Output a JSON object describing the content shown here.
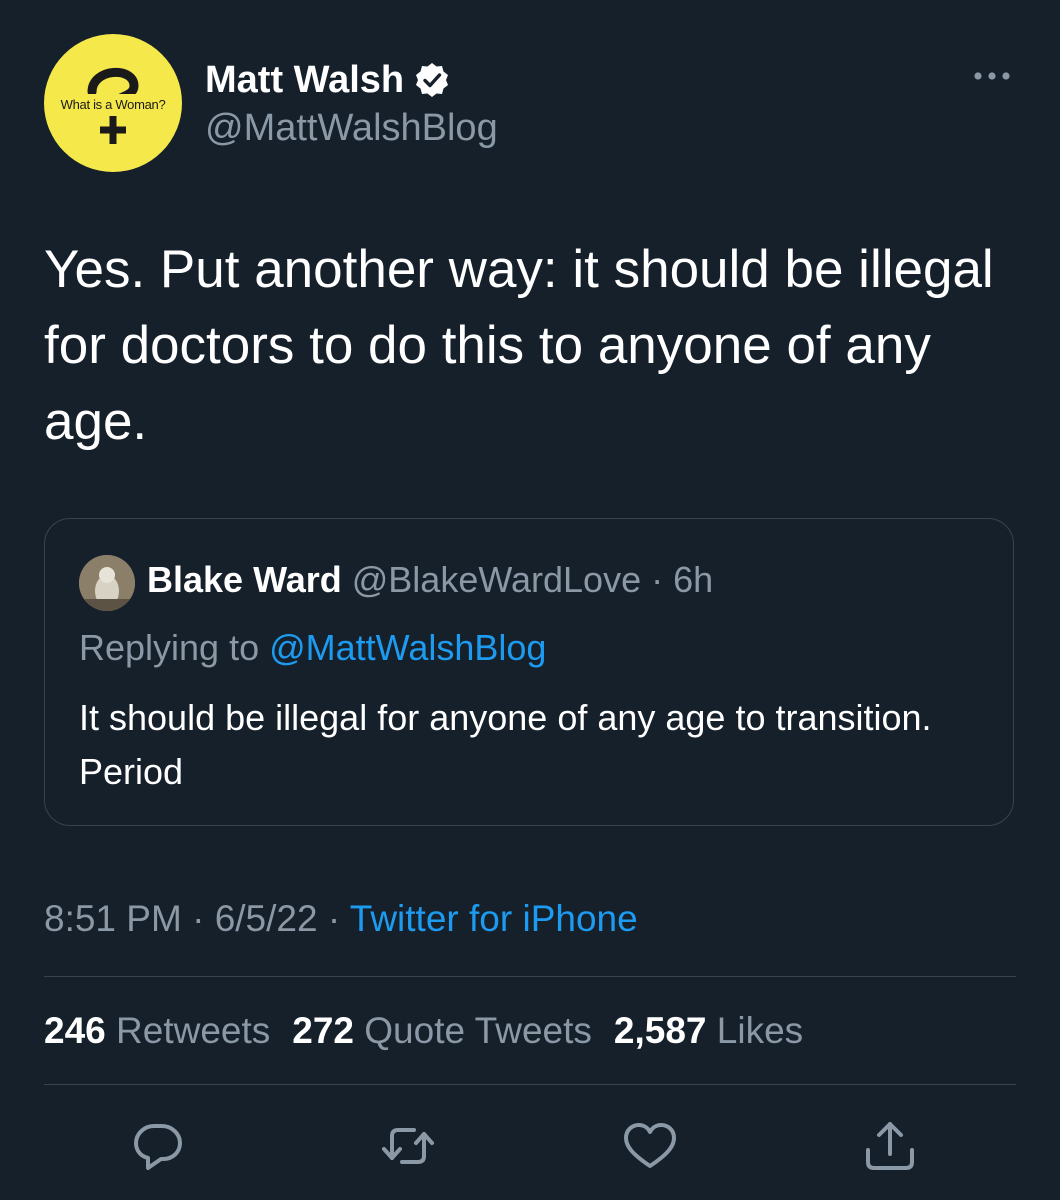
{
  "author": {
    "avatar_text": "What is a Woman?",
    "name": "Matt Walsh",
    "handle": "@MattWalshBlog",
    "verified": true
  },
  "tweet": {
    "text": "Yes. Put another way: it should be illegal for doctors to do this to anyone of any age.",
    "time": "8:51 PM",
    "date": "6/5/22",
    "source": "Twitter for iPhone",
    "separator": " · "
  },
  "quoted_tweet": {
    "name": "Blake Ward",
    "handle": "@BlakeWardLove",
    "age": "6h",
    "replying_label": "Replying to",
    "replying_to": "@MattWalshBlog",
    "text": "It should be illegal for anyone of any age to transition. Period"
  },
  "stats": {
    "retweets_count": "246",
    "retweets_label": "Retweets",
    "quotes_count": "272",
    "quotes_label": "Quote Tweets",
    "likes_count": "2,587",
    "likes_label": "Likes"
  },
  "colors": {
    "background": "#15202b",
    "accent": "#1d9bf0",
    "secondary_text": "#8b98a5",
    "avatar_yellow": "#f5e84b"
  },
  "icons": [
    "verified-badge-icon",
    "more-icon",
    "reply-icon",
    "retweet-icon",
    "like-icon",
    "share-icon"
  ]
}
